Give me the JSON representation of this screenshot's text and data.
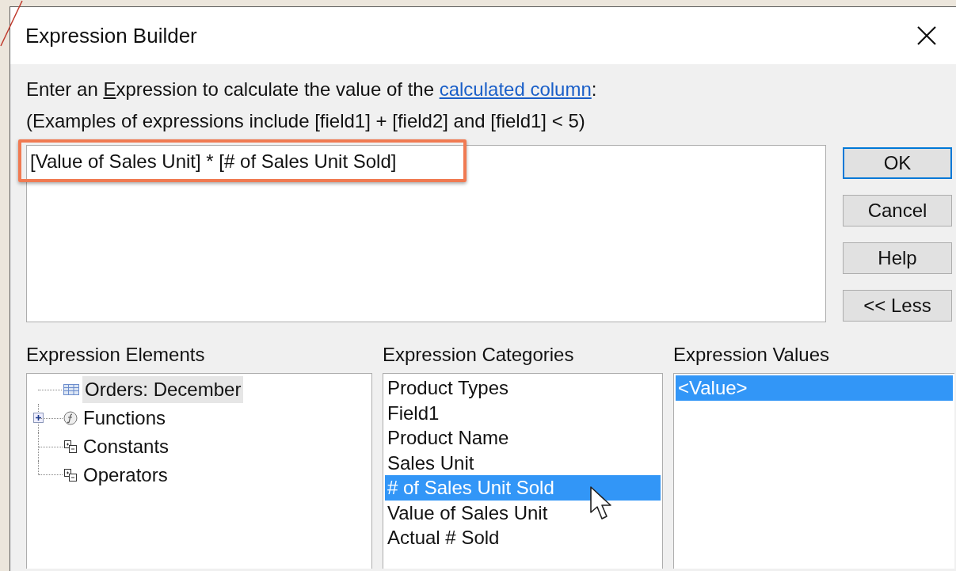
{
  "window": {
    "title": "Expression Builder"
  },
  "instructions": {
    "prefix": "Enter an ",
    "access_key": "E",
    "text": "xpression to calculate the value of the ",
    "link": "calculated column",
    "suffix": ":"
  },
  "examples": "(Examples of expressions include [field1] + [field2] and [field1] < 5)",
  "expression": {
    "value": "[Value of Sales Unit] * [# of Sales Unit Sold]",
    "highlighted": true
  },
  "buttons": [
    {
      "label": "OK",
      "default": true
    },
    {
      "label": "Cancel",
      "default": false
    },
    {
      "label": "Help",
      "default": false
    },
    {
      "label": "<< Less",
      "default": false
    }
  ],
  "elements": {
    "label": "Expression Elements",
    "items": [
      {
        "label": "Orders: December",
        "kind": "table",
        "selected": true
      },
      {
        "label": "Functions",
        "kind": "function",
        "selected": false,
        "expanded": false
      },
      {
        "label": "Constants",
        "kind": "group",
        "selected": false
      },
      {
        "label": "Operators",
        "kind": "group",
        "selected": false
      }
    ]
  },
  "categories": {
    "label": "Expression Categories",
    "items": [
      {
        "label": "Product Types",
        "selected": false
      },
      {
        "label": "Field1",
        "selected": false
      },
      {
        "label": "Product Name",
        "selected": false
      },
      {
        "label": "Sales Unit",
        "selected": false
      },
      {
        "label": "# of Sales Unit Sold",
        "selected": true
      },
      {
        "label": "Value of Sales Unit",
        "selected": false
      },
      {
        "label": "Actual # Sold",
        "selected": false
      }
    ]
  },
  "values": {
    "label": "Expression Values",
    "items": [
      {
        "label": "<Value>",
        "selected": true
      }
    ]
  }
}
